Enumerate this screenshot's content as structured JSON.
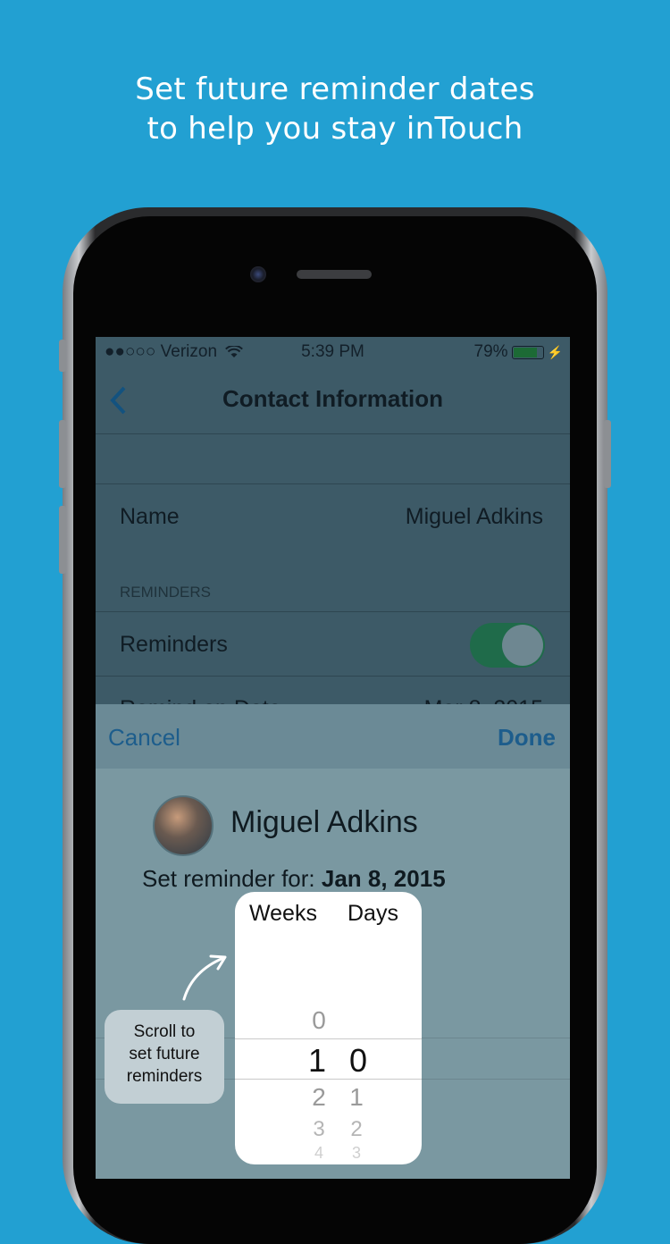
{
  "headline": {
    "line1": "Set future reminder dates",
    "line2": "to help you stay inTouch"
  },
  "status_bar": {
    "carrier": "●●○○○ Verizon",
    "time": "5:39 PM",
    "battery": "79%",
    "battery_level": 0.79
  },
  "nav": {
    "back_icon": "chevron-left-icon",
    "title": "Contact Information"
  },
  "contact_rows": {
    "name_label": "Name",
    "name_value": "Miguel Adkins",
    "section_header": "REMINDERS",
    "reminders_label": "Reminders",
    "reminders_on": true,
    "remind_date_label": "Remind on Date",
    "remind_date_value": "Mar 8, 2015"
  },
  "sheet": {
    "cancel": "Cancel",
    "done": "Done",
    "contact_name": "Miguel Adkins",
    "set_reminder_prefix": "Set reminder for:",
    "set_reminder_date": "Jan 8, 2015"
  },
  "picker": {
    "weeks_label": "Weeks",
    "days_label": "Days",
    "weeks": [
      "0",
      "1",
      "2",
      "3",
      "4"
    ],
    "days": [
      "0",
      "1",
      "2",
      "3"
    ],
    "selected_week": "1",
    "selected_day": "0"
  },
  "hint": {
    "text_line1": "Scroll to",
    "text_line2": "set future",
    "text_line3": "reminders"
  },
  "colors": {
    "background": "#22a0d2",
    "accent_blue": "#1d5d8c",
    "toggle_green": "#1f6b4a"
  }
}
